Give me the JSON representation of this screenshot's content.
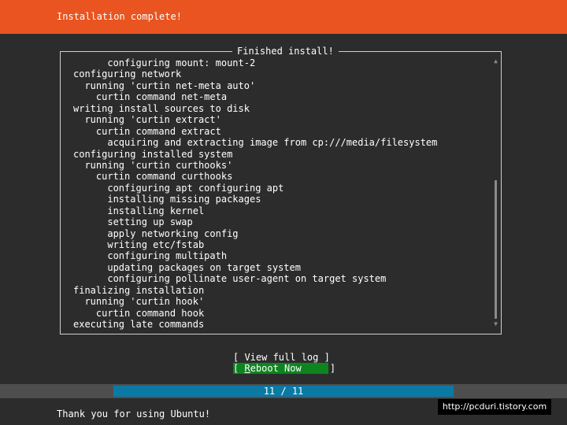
{
  "header": {
    "title": "Installation complete!",
    "background_color": "#e95420"
  },
  "log": {
    "legend": "Finished install!",
    "lines": [
      "      configuring mount: mount-2",
      "configuring network",
      "  running 'curtin net-meta auto'",
      "    curtin command net-meta",
      "writing install sources to disk",
      "  running 'curtin extract'",
      "    curtin command extract",
      "      acquiring and extracting image from cp:///media/filesystem",
      "configuring installed system",
      "  running 'curtin curthooks'",
      "    curtin command curthooks",
      "      configuring apt configuring apt",
      "      installing missing packages",
      "      installing kernel",
      "      setting up swap",
      "      apply networking config",
      "      writing etc/fstab",
      "      configuring multipath",
      "      updating packages on target system",
      "      configuring pollinate user-agent on target system",
      "finalizing installation",
      "  running 'curtin hook'",
      "    curtin command hook",
      "executing late commands"
    ],
    "scroll": {
      "thumb_start": 0.45,
      "thumb_size": 0.55,
      "up_arrow": "▲",
      "down_arrow": "▼"
    }
  },
  "actions": {
    "view_log": {
      "left": "[ ",
      "label": "View full log",
      "right": " ]"
    },
    "reboot": {
      "left": "[ ",
      "hotkey": "R",
      "rest": "eboot Now",
      "right": "     ]",
      "color": "#0e8420"
    }
  },
  "progress": {
    "current": 11,
    "total": 11,
    "text": "11 / 11",
    "color": "#0a7aa5"
  },
  "footer": {
    "text": "Thank you for using Ubuntu!"
  },
  "watermark": {
    "text": "http://pcduri.tistory.com"
  }
}
